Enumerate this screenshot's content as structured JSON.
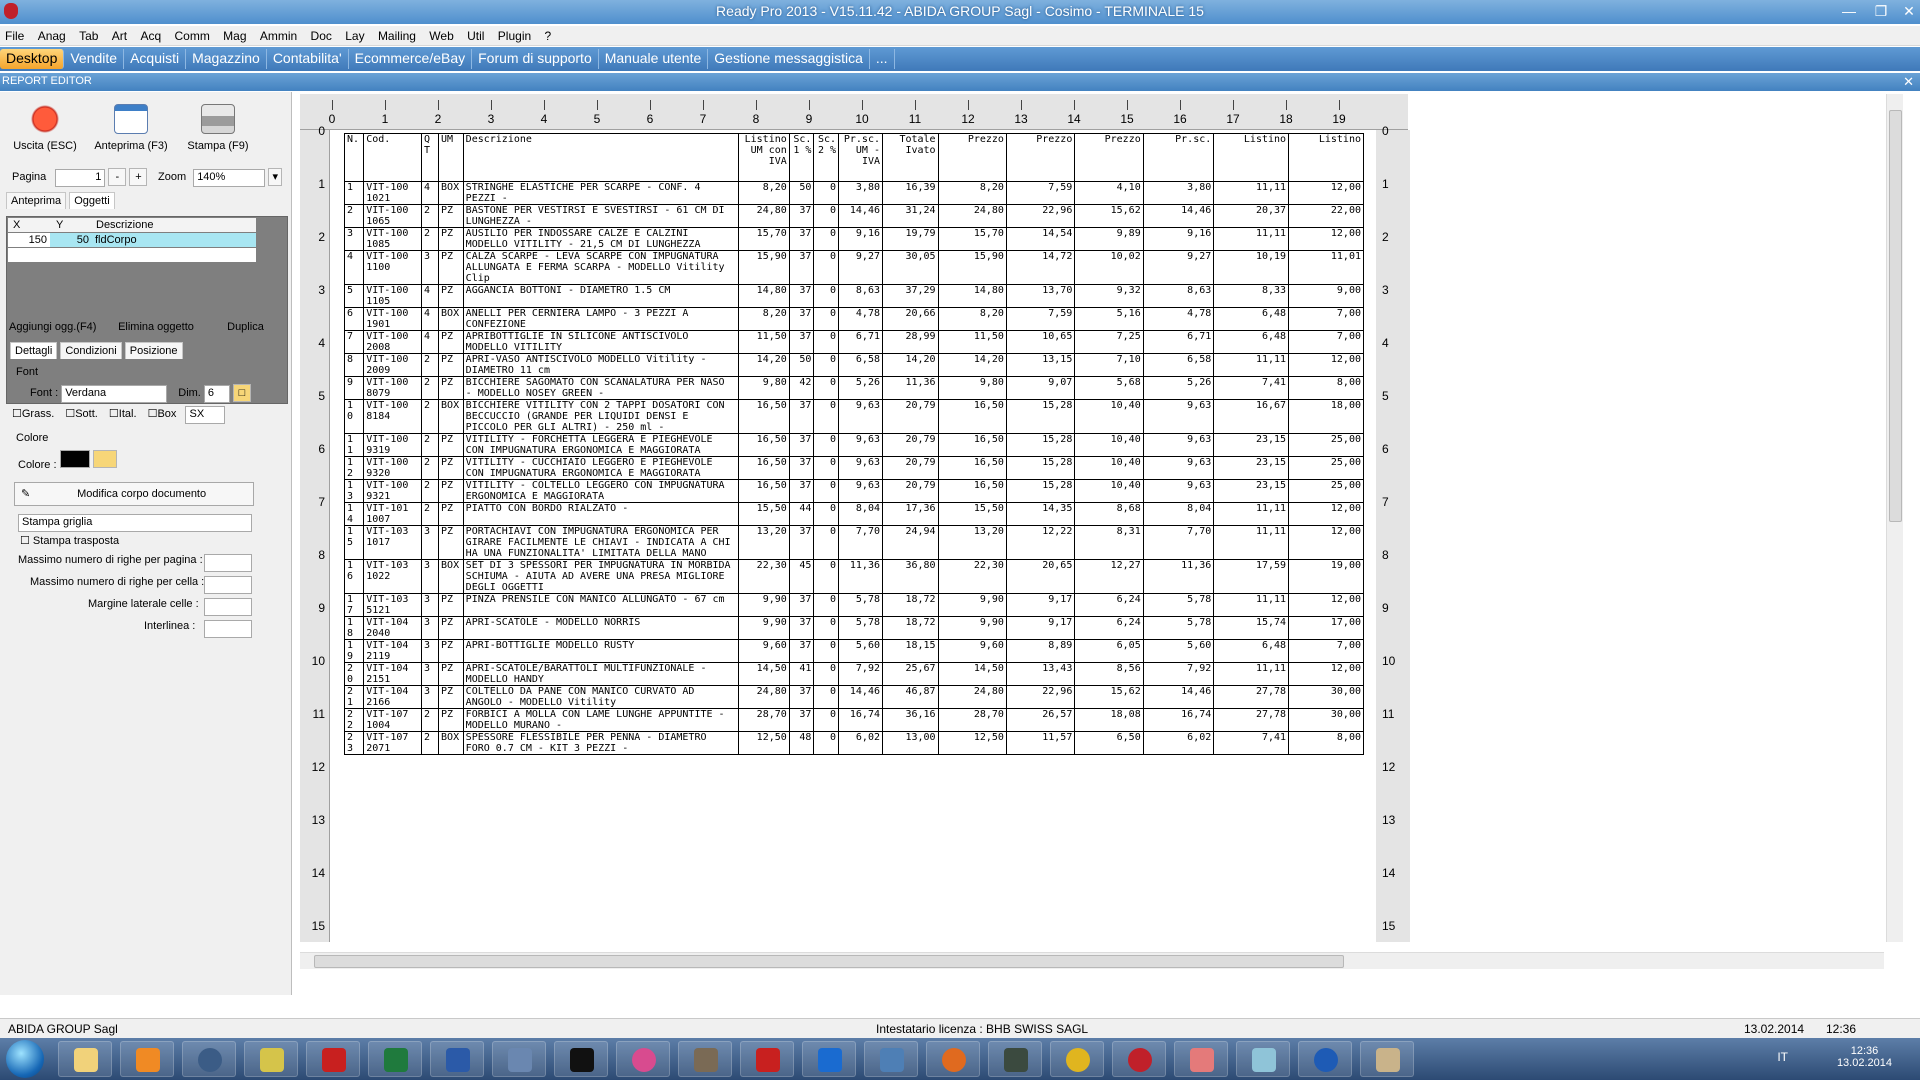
{
  "window": {
    "title": "Ready Pro 2013 - V15.11.42 - ABIDA GROUP Sagl - Cosimo - TERMINALE 15"
  },
  "menu": [
    "File",
    "Anag",
    "Tab",
    "Art",
    "Acq",
    "Comm",
    "Mag",
    "Ammin",
    "Doc",
    "Lay",
    "Mailing",
    "Web",
    "Util",
    "Plugin",
    "?"
  ],
  "tabs": [
    "Desktop",
    "Vendite",
    "Acquisti",
    "Magazzino",
    "Contabilita'",
    "Ecommerce/eBay",
    "Forum di supporto",
    "Manuale utente",
    "Gestione messaggistica",
    "..."
  ],
  "editor": {
    "header": "REPORT EDITOR",
    "buttons": {
      "exit": "Uscita (ESC)",
      "preview": "Anteprima (F3)",
      "print": "Stampa (F9)"
    },
    "page_label": "Pagina",
    "page_value": "1",
    "zoom_label": "Zoom",
    "zoom_value": "140%",
    "view_tabs": [
      "Anteprima",
      "Oggetti"
    ],
    "objects_grid": {
      "headers": [
        "X",
        "Y",
        "Descrizione"
      ],
      "row": [
        "150",
        "50",
        "fldCorpo"
      ]
    },
    "actions": [
      "Aggiungi ogg.(F4)",
      "Elimina oggetto",
      "Duplica"
    ],
    "detail_tabs": [
      "Dettagli",
      "Condizioni",
      "Posizione"
    ],
    "font_group": "Font",
    "font_label": "Font :",
    "font_value": "Verdana",
    "dim_label": "Dim.",
    "dim_value": "6",
    "style_checks": [
      "Grass.",
      "Sott.",
      "Ital.",
      "Box"
    ],
    "align_value": "SX",
    "color_group": "Colore",
    "color_label": "Colore :",
    "modify_body": "Modifica corpo documento",
    "grid_print": "Stampa griglia",
    "transposed": "Stampa trasposta",
    "fields": [
      "Massimo numero di righe per pagina :",
      "Massimo numero di righe per cella :",
      "Margine laterale celle :",
      "Interlinea :"
    ]
  },
  "ruler": {
    "top": [
      "0",
      "1",
      "2",
      "3",
      "4",
      "5",
      "6",
      "7",
      "8",
      "9",
      "10",
      "11",
      "12",
      "13",
      "14",
      "15",
      "16",
      "17",
      "18",
      "19"
    ],
    "side": [
      "0",
      "1",
      "2",
      "3",
      "4",
      "5",
      "6",
      "7",
      "8",
      "9",
      "10",
      "11",
      "12",
      "13",
      "14",
      "15"
    ]
  },
  "report": {
    "headers": [
      "N.",
      "Cod.",
      "Q T",
      "UM",
      "Descrizione",
      "Listino UM con IVA",
      "Sc. 1 %",
      "Sc. 2 %",
      "Pr.sc. UM -IVA",
      "Totale Ivato",
      "Prezzo",
      "Prezzo",
      "Prezzo",
      "Pr.sc.",
      "Listino",
      "Listino"
    ],
    "rows": [
      [
        "1",
        "VIT-100 1021",
        "4",
        "BOX",
        "STRINGHE ELASTICHE PER SCARPE - CONF. 4 PEZZI -",
        "8,20",
        "50",
        "0",
        "3,80",
        "16,39",
        "8,20",
        "7,59",
        "4,10",
        "3,80",
        "11,11",
        "12,00"
      ],
      [
        "2",
        "VIT-100 1065",
        "2",
        "PZ",
        "BASTONE PER VESTIRSI E SVESTIRSI - 61 CM DI LUNGHEZZA -",
        "24,80",
        "37",
        "0",
        "14,46",
        "31,24",
        "24,80",
        "22,96",
        "15,62",
        "14,46",
        "20,37",
        "22,00"
      ],
      [
        "3",
        "VIT-100 1085",
        "2",
        "PZ",
        "AUSILIO PER INDOSSARE CALZE E CALZINI MODELLO VITILITY - 21,5 CM DI LUNGHEZZA",
        "15,70",
        "37",
        "0",
        "9,16",
        "19,79",
        "15,70",
        "14,54",
        "9,89",
        "9,16",
        "11,11",
        "12,00"
      ],
      [
        "4",
        "VIT-100 1100",
        "3",
        "PZ",
        "CALZA SCARPE - LEVA SCARPE CON IMPUGNATURA ALLUNGATA E FERMA SCARPA - MODELLO Vitility Clip",
        "15,90",
        "37",
        "0",
        "9,27",
        "30,05",
        "15,90",
        "14,72",
        "10,02",
        "9,27",
        "10,19",
        "11,01"
      ],
      [
        "5",
        "VIT-100 1105",
        "4",
        "PZ",
        "AGGANCIA BOTTONI - DIAMETRO 1.5 CM",
        "14,80",
        "37",
        "0",
        "8,63",
        "37,29",
        "14,80",
        "13,70",
        "9,32",
        "8,63",
        "8,33",
        "9,00"
      ],
      [
        "6",
        "VIT-100 1901",
        "4",
        "BOX",
        "ANELLI PER CERNIERA LAMPO - 3 PEZZI A CONFEZIONE",
        "8,20",
        "37",
        "0",
        "4,78",
        "20,66",
        "8,20",
        "7,59",
        "5,16",
        "4,78",
        "6,48",
        "7,00"
      ],
      [
        "7",
        "VIT-100 2008",
        "4",
        "PZ",
        "APRIBOTTIGLIE IN SILICONE ANTISCIVOLO MODELLO VITILITY",
        "11,50",
        "37",
        "0",
        "6,71",
        "28,99",
        "11,50",
        "10,65",
        "7,25",
        "6,71",
        "6,48",
        "7,00"
      ],
      [
        "8",
        "VIT-100 2009",
        "2",
        "PZ",
        "APRI-VASO ANTISCIVOLO MODELLO Vitility - DIAMETRO 11 cm",
        "14,20",
        "50",
        "0",
        "6,58",
        "14,20",
        "14,20",
        "13,15",
        "7,10",
        "6,58",
        "11,11",
        "12,00"
      ],
      [
        "9",
        "VIT-100 8079",
        "2",
        "PZ",
        "BICCHIERE SAGOMATO CON SCANALATURA PER NASO - MODELLO NOSEY GREEN -",
        "9,80",
        "42",
        "0",
        "5,26",
        "11,36",
        "9,80",
        "9,07",
        "5,68",
        "5,26",
        "7,41",
        "8,00"
      ],
      [
        "1 0",
        "VIT-100 8184",
        "2",
        "BOX",
        "BICCHIERE VITILITY CON 2 TAPPI DOSATORI CON BECCUCCIO (GRANDE PER LIQUIDI DENSI E PICCOLO PER GLI ALTRI) - 250 ml -",
        "16,50",
        "37",
        "0",
        "9,63",
        "20,79",
        "16,50",
        "15,28",
        "10,40",
        "9,63",
        "16,67",
        "18,00"
      ],
      [
        "1 1",
        "VIT-100 9319",
        "2",
        "PZ",
        "VITILITY - FORCHETTA LEGGERA E PIEGHEVOLE CON IMPUGNATURA ERGONOMICA E MAGGIORATA",
        "16,50",
        "37",
        "0",
        "9,63",
        "20,79",
        "16,50",
        "15,28",
        "10,40",
        "9,63",
        "23,15",
        "25,00"
      ],
      [
        "1 2",
        "VIT-100 9320",
        "2",
        "PZ",
        "VITILITY - CUCCHIAIO LEGGERO E PIEGHEVOLE CON IMPUGNATURA ERGONOMICA E MAGGIORATA",
        "16,50",
        "37",
        "0",
        "9,63",
        "20,79",
        "16,50",
        "15,28",
        "10,40",
        "9,63",
        "23,15",
        "25,00"
      ],
      [
        "1 3",
        "VIT-100 9321",
        "2",
        "PZ",
        "VITILITY - COLTELLO LEGGERO CON IMPUGNATURA ERGONOMICA E MAGGIORATA",
        "16,50",
        "37",
        "0",
        "9,63",
        "20,79",
        "16,50",
        "15,28",
        "10,40",
        "9,63",
        "23,15",
        "25,00"
      ],
      [
        "1 4",
        "VIT-101 1007",
        "2",
        "PZ",
        "PIATTO CON BORDO RIALZATO -",
        "15,50",
        "44",
        "0",
        "8,04",
        "17,36",
        "15,50",
        "14,35",
        "8,68",
        "8,04",
        "11,11",
        "12,00"
      ],
      [
        "1 5",
        "VIT-103 1017",
        "3",
        "PZ",
        "PORTACHIAVI CON IMPUGNATURA ERGONOMICA PER GIRARE FACILMENTE LE CHIAVI - INDICATA A CHI HA UNA FUNZIONALITA' LIMITATA DELLA MANO",
        "13,20",
        "37",
        "0",
        "7,70",
        "24,94",
        "13,20",
        "12,22",
        "8,31",
        "7,70",
        "11,11",
        "12,00"
      ],
      [
        "1 6",
        "VIT-103 1022",
        "3",
        "BOX",
        "SET DI 3 SPESSORI PER IMPUGNATURA IN MORBIDA SCHIUMA - AIUTA AD AVERE UNA PRESA MIGLIORE DEGLI OGGETTI",
        "22,30",
        "45",
        "0",
        "11,36",
        "36,80",
        "22,30",
        "20,65",
        "12,27",
        "11,36",
        "17,59",
        "19,00"
      ],
      [
        "1 7",
        "VIT-103 5121",
        "3",
        "PZ",
        "PINZA PRENSILE CON MANICO ALLUNGATO - 67 cm",
        "9,90",
        "37",
        "0",
        "5,78",
        "18,72",
        "9,90",
        "9,17",
        "6,24",
        "5,78",
        "11,11",
        "12,00"
      ],
      [
        "1 8",
        "VIT-104 2040",
        "3",
        "PZ",
        "APRI-SCATOLE - MODELLO NORRIS",
        "9,90",
        "37",
        "0",
        "5,78",
        "18,72",
        "9,90",
        "9,17",
        "6,24",
        "5,78",
        "15,74",
        "17,00"
      ],
      [
        "1 9",
        "VIT-104 2119",
        "3",
        "PZ",
        "APRI-BOTTIGLIE MODELLO RUSTY",
        "9,60",
        "37",
        "0",
        "5,60",
        "18,15",
        "9,60",
        "8,89",
        "6,05",
        "5,60",
        "6,48",
        "7,00"
      ],
      [
        "2 0",
        "VIT-104 2151",
        "3",
        "PZ",
        "APRI-SCATOLE/BARATTOLI MULTIFUNZIONALE - MODELLO HANDY",
        "14,50",
        "41",
        "0",
        "7,92",
        "25,67",
        "14,50",
        "13,43",
        "8,56",
        "7,92",
        "11,11",
        "12,00"
      ],
      [
        "2 1",
        "VIT-104 2166",
        "3",
        "PZ",
        "COLTELLO DA PANE CON MANICO CURVATO AD ANGOLO - MODELLO Vitility",
        "24,80",
        "37",
        "0",
        "14,46",
        "46,87",
        "24,80",
        "22,96",
        "15,62",
        "14,46",
        "27,78",
        "30,00"
      ],
      [
        "2 2",
        "VIT-107 1004",
        "2",
        "PZ",
        "FORBICI A MOLLA CON LAME LUNGHE APPUNTITE - MODELLO MURANO -",
        "28,70",
        "37",
        "0",
        "16,74",
        "36,16",
        "28,70",
        "26,57",
        "18,08",
        "16,74",
        "27,78",
        "30,00"
      ],
      [
        "2 3",
        "VIT-107 2071",
        "2",
        "BOX",
        "SPESSORE FLESSIBILE PER PENNA - DIAMETRO FORO 0.7 CM - KIT 3 PEZZI -",
        "12,50",
        "48",
        "0",
        "6,02",
        "13,00",
        "12,50",
        "11,57",
        "6,50",
        "6,02",
        "7,41",
        "8,00"
      ]
    ]
  },
  "status": {
    "company": "ABIDA GROUP Sagl",
    "license": "Intestatario licenza : BHB SWISS SAGL",
    "date": "13.02.2014",
    "time": "12:36"
  },
  "taskbar": {
    "lang": "IT",
    "clock_time": "12:36",
    "clock_date": "13.02.2014"
  }
}
